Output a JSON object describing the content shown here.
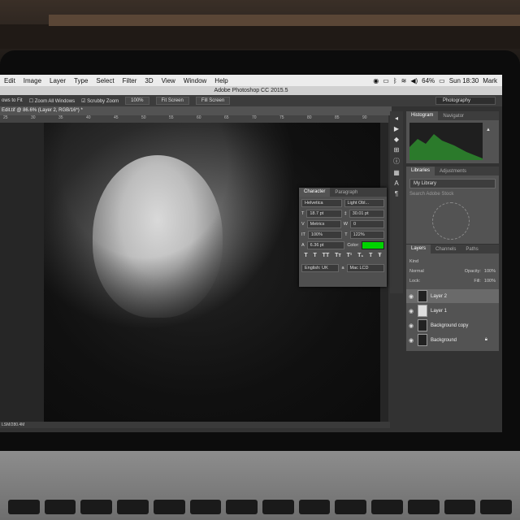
{
  "mac_menu": {
    "items": [
      "Edit",
      "Image",
      "Layer",
      "Type",
      "Select",
      "Filter",
      "3D",
      "View",
      "Window",
      "Help"
    ],
    "battery": "64%",
    "clock": "Sun 18:30",
    "user": "Mark"
  },
  "app": {
    "title": "Adobe Photoshop CC 2015.5"
  },
  "options_bar": {
    "resize_label": "ows to Fit",
    "zoom_all": "Zoom All Windows",
    "scrubby": "Scrubby Zoom",
    "zoom_100": "100%",
    "fit_screen": "Fit Screen",
    "fill_screen": "Fill Screen",
    "workspace": "Photography"
  },
  "document": {
    "tab": "Edit.tif @ 86.6% (Layer 2, RGB/16*) *",
    "status": "LSM/280.4M"
  },
  "ruler_ticks": [
    "25",
    "30",
    "35",
    "40",
    "45",
    "50",
    "55",
    "60",
    "65",
    "70",
    "75",
    "80",
    "85",
    "90"
  ],
  "tools": {
    "glyphs": [
      "◂",
      "▶",
      "◆",
      "⊞",
      "ⓘ",
      "▦",
      "A",
      "¶"
    ]
  },
  "histogram": {
    "tabs": [
      "Histogram",
      "Navigator"
    ]
  },
  "libraries": {
    "tabs": [
      "Libraries",
      "Adjustments"
    ],
    "library": "My Library",
    "search_placeholder": "Search Adobe Stock"
  },
  "layers_panel": {
    "tabs": [
      "Layers",
      "Channels",
      "Paths"
    ],
    "kind": "Kind",
    "blend": "Normal",
    "opacity_label": "Opacity:",
    "opacity": "100%",
    "lock_label": "Lock:",
    "fill_label": "Fill:",
    "fill": "100%",
    "layers": [
      {
        "name": "Layer 2"
      },
      {
        "name": "Layer 1"
      },
      {
        "name": "Background copy"
      },
      {
        "name": "Background"
      }
    ]
  },
  "character": {
    "tabs": [
      "Character",
      "Paragraph"
    ],
    "font": "Helvetica",
    "style": "Light Obl...",
    "size": "18.7 pt",
    "leading": "30.01 pt",
    "kerning": "Metrics",
    "tracking": "0",
    "vscale": "100%",
    "hscale": "122%",
    "baseline": "6.36 pt",
    "color_label": "Color:",
    "color": "#00d400",
    "type_buttons": [
      "T",
      "T",
      "TT",
      "Tт",
      "T¹",
      "T₁",
      "T",
      "Ŧ"
    ],
    "language": "English: UK",
    "antialias": "Mac LCD"
  },
  "colors": {
    "menubar": "#ececec",
    "panel": "#535353",
    "accent_green": "#00d400"
  }
}
